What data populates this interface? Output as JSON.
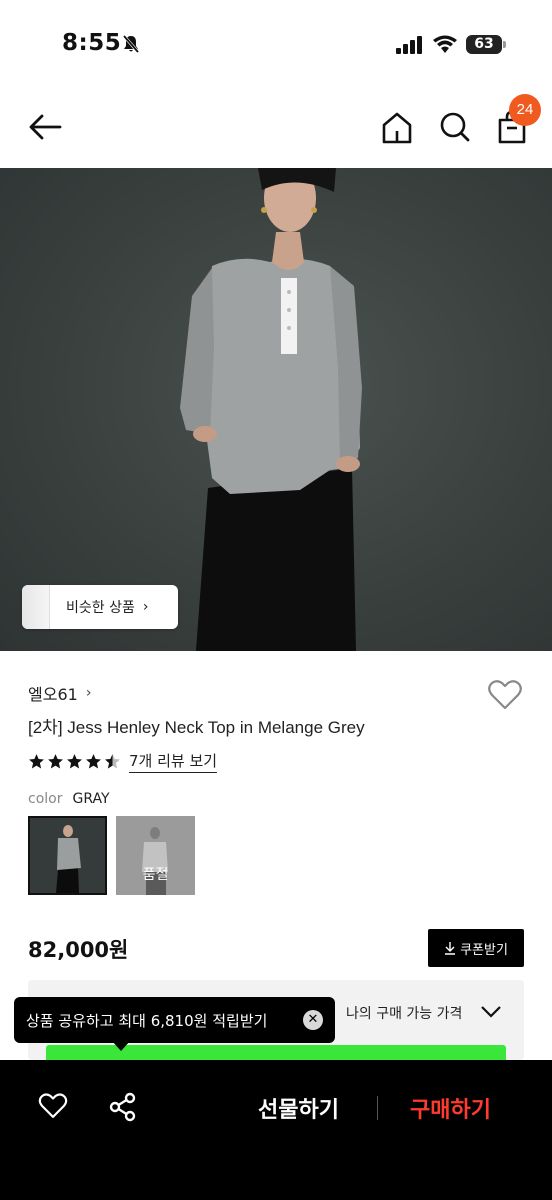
{
  "status": {
    "time": "8:55",
    "battery": "63"
  },
  "nav": {
    "cart_count": "24"
  },
  "similar": {
    "label": "비슷한 상품"
  },
  "product": {
    "brand": "엘오61",
    "title": "[2차] Jess Henley Neck Top in Melange Grey",
    "rating": 4.5,
    "review_link": "7개 리뷰 보기",
    "color_label": "color",
    "color_value": "GRAY",
    "soldout_label": "품절",
    "price": "82,000원"
  },
  "coupon": {
    "label": "쿠폰받기"
  },
  "my_price": {
    "label": "나의 구매 가능 가격"
  },
  "tooltip": {
    "text": "상품 공유하고 최대 6,810원 적립받기"
  },
  "bottom": {
    "gift": "선물하기",
    "buy": "구매하기"
  },
  "colors": {
    "badge": "#f05a1e",
    "buy": "#ff3b2f",
    "green": "#39e639"
  }
}
